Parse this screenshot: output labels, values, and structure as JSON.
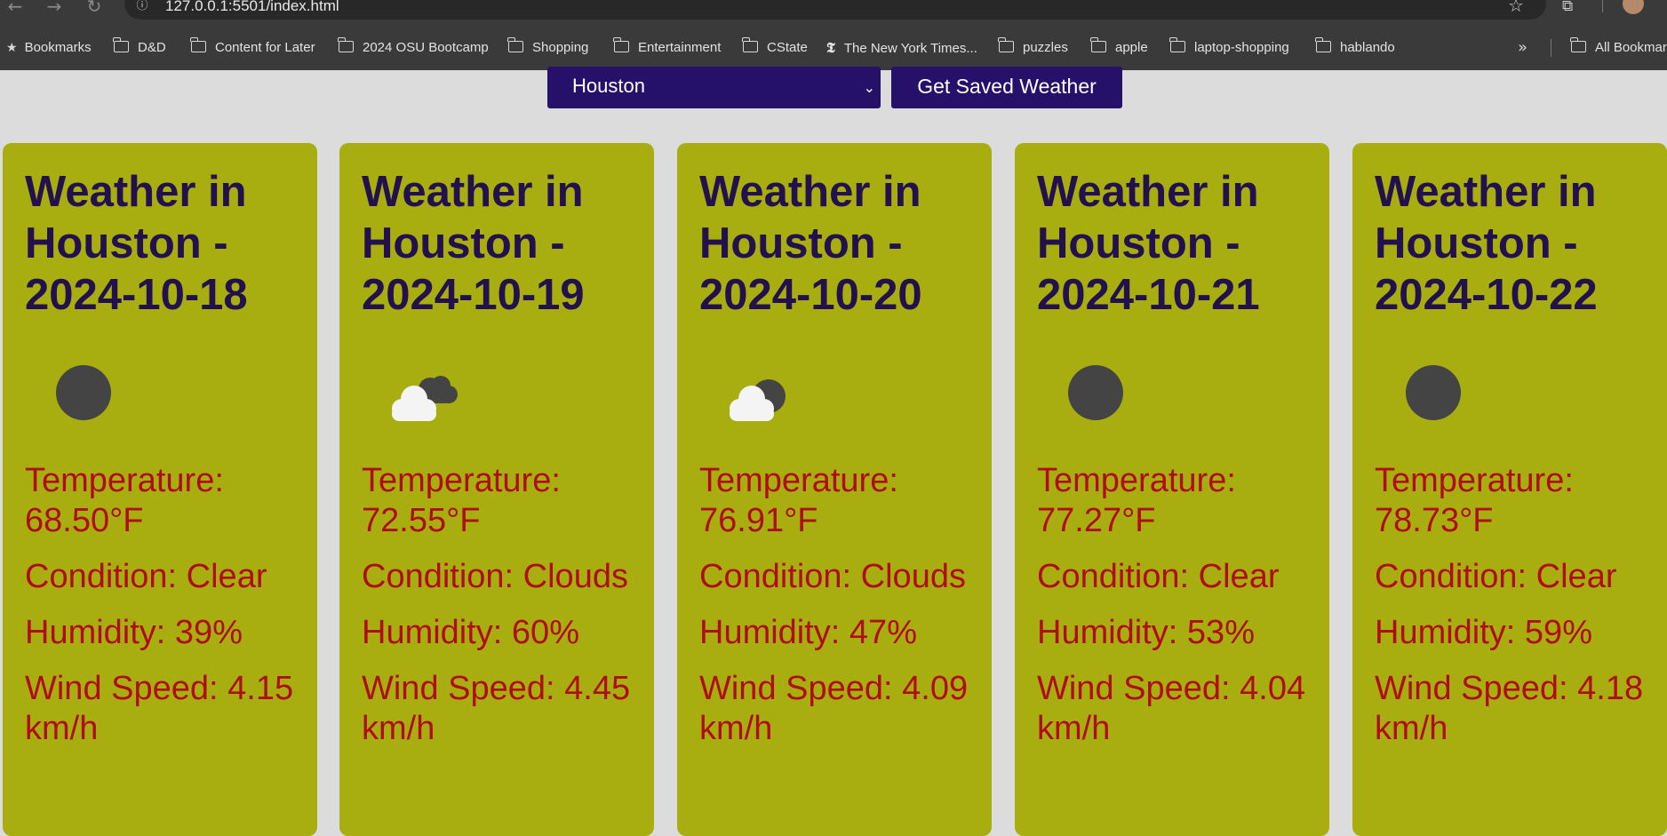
{
  "browser": {
    "url": "127.0.0.1:5501/index.html",
    "bookmarks": [
      {
        "label": "Bookmarks",
        "icon": "star-icon"
      },
      {
        "label": "D&D",
        "icon": "folder-icon"
      },
      {
        "label": "Content for Later",
        "icon": "folder-icon"
      },
      {
        "label": "2024 OSU Bootcamp",
        "icon": "folder-icon"
      },
      {
        "label": "Shopping",
        "icon": "folder-icon"
      },
      {
        "label": "Entertainment",
        "icon": "folder-icon"
      },
      {
        "label": "CState",
        "icon": "folder-icon"
      },
      {
        "label": "The New York Times...",
        "icon": "nyt-icon"
      },
      {
        "label": "puzzles",
        "icon": "folder-icon"
      },
      {
        "label": "apple",
        "icon": "folder-icon"
      },
      {
        "label": "laptop-shopping",
        "icon": "folder-icon"
      },
      {
        "label": "hablando",
        "icon": "folder-icon"
      }
    ],
    "overflow": "»",
    "all_bookmarks": "All Bookmar"
  },
  "controls": {
    "selected_city": "Houston",
    "button_label": "Get Saved Weather"
  },
  "forecast": [
    {
      "title": "Weather in Houston - 2024-10-18",
      "icon": "clear-icon",
      "temperature": "Temperature: 68.50°F",
      "condition": "Condition: Clear",
      "humidity": "Humidity: 39%",
      "wind": "Wind Speed: 4.15 km/h"
    },
    {
      "title": "Weather in Houston - 2024-10-19",
      "icon": "clouds-icon",
      "temperature": "Temperature: 72.55°F",
      "condition": "Condition: Clouds",
      "humidity": "Humidity: 60%",
      "wind": "Wind Speed: 4.45 km/h"
    },
    {
      "title": "Weather in Houston - 2024-10-20",
      "icon": "partly-cloudy-icon",
      "temperature": "Temperature: 76.91°F",
      "condition": "Condition: Clouds",
      "humidity": "Humidity: 47%",
      "wind": "Wind Speed: 4.09 km/h"
    },
    {
      "title": "Weather in Houston - 2024-10-21",
      "icon": "clear-icon",
      "temperature": "Temperature: 77.27°F",
      "condition": "Condition: Clear",
      "humidity": "Humidity: 53%",
      "wind": "Wind Speed: 4.04 km/h"
    },
    {
      "title": "Weather in Houston - 2024-10-22",
      "icon": "clear-icon",
      "temperature": "Temperature: 78.73°F",
      "condition": "Condition: Clear",
      "humidity": "Humidity: 59%",
      "wind": "Wind Speed: 4.18 km/h"
    }
  ]
}
